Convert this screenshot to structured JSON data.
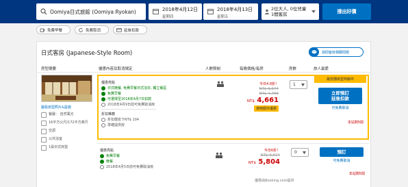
{
  "search": {
    "destination": "Oomiya日式旅館 (Oomiya Ryokan)",
    "checkin_date": "2018年4月12日",
    "checkin_weekday": "星期四",
    "checkout_date": "2018年4月13日",
    "checkout_weekday": "星期五",
    "guests_line1": "2位大人, 0位兒童",
    "guests_line2": "1間客房",
    "search_button": "搜出好價"
  },
  "filters": [
    {
      "label": "免費早餐",
      "icon": "coffee-icon"
    },
    {
      "label": "免費取消",
      "icon": "refresh-icon"
    },
    {
      "label": "延後扣款",
      "icon": "card-icon"
    }
  ],
  "room": {
    "title": "日式客房 (Japanese-Style Room)",
    "ask_button": "詢問客房相關問題",
    "headers": {
      "room_type": "房型摘要",
      "conditions": "優惠內容及取消規定",
      "occupancy": "人數限制",
      "price": "每晚價格/每房",
      "rooms": "房數",
      "guests": "旅人最愛"
    },
    "photo_link": "圖看房型照片&設施",
    "facilities": [
      "餐廳： 自然風光",
      "16平方公尺/172平方英尺",
      "空調",
      "公共浴室",
      "1張日式床墊"
    ]
  },
  "options": [
    {
      "cond_title": "優惠亮點",
      "conditions": [
        {
          "text": "日式晚餐, 免費早餐日式浴衣, 獨立餐區",
          "style": "green"
        },
        {
          "text": "免費早餐",
          "style": "green"
        },
        {
          "text": "可選擇至2018年4月7日扣款",
          "style": "green"
        },
        {
          "text": "2018年4月9日前可免費取消房",
          "style": "grey"
        }
      ],
      "extra_title": "折扣推薦",
      "extras": [
        {
          "text": "折扣價省下NT$ 104",
          "style": "grey"
        },
        {
          "text": "準確提供房",
          "style": "grey"
        }
      ],
      "discount": "今日4.8折！",
      "original_price": "NT$ 9,674",
      "previous_price": "NT$ 4,766",
      "current_currency": "NT$",
      "current_amount": "4,661",
      "tag": "適用額外優惠",
      "qty": "1",
      "best_label": "最低價房型熱銷中",
      "book_line1": "立即預訂",
      "book_line2": "延後扣款",
      "free_cancel": "可免費取消",
      "rooms_left": "本站剩5間"
    },
    {
      "cond_title": "優惠亮點",
      "conditions": [
        {
          "text": "免費早餐",
          "style": "green"
        },
        {
          "text": "晚餐",
          "style": "green"
        },
        {
          "text": "2018年4月5日前可免費取消房",
          "style": "grey"
        }
      ],
      "discount": "今日6折！",
      "original_price": "NT$ 9,674",
      "current_currency": "NT$",
      "current_amount": "5,804",
      "source_note": "優惠由Booking.com提供",
      "qty": "0",
      "book_line1": "預訂",
      "free_cancel": "可免費取消",
      "rooms_left": "本站剩5間"
    }
  ]
}
